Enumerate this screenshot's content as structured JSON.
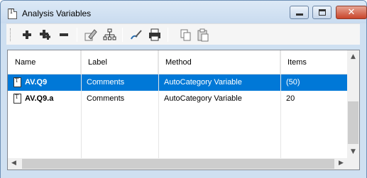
{
  "window": {
    "title": "Analysis Variables",
    "controls": {
      "minimize": "minimize",
      "maximize": "maximize",
      "close": "✕"
    }
  },
  "toolbar": {
    "buttons": [
      {
        "name": "add",
        "icon": "plus-icon"
      },
      {
        "name": "add-child",
        "icon": "plus-child-icon"
      },
      {
        "name": "remove",
        "icon": "minus-icon"
      },
      {
        "name": "edit",
        "icon": "pencil-edit-icon"
      },
      {
        "name": "hierarchy",
        "icon": "hierarchy-icon"
      },
      {
        "name": "style",
        "icon": "brush-icon"
      },
      {
        "name": "print",
        "icon": "printer-icon"
      },
      {
        "name": "copy",
        "icon": "copy-icon"
      },
      {
        "name": "paste",
        "icon": "paste-icon"
      }
    ]
  },
  "grid": {
    "columns": [
      "Name",
      "Label",
      "Method",
      "Items"
    ],
    "rows": [
      {
        "name": "AV.Q9",
        "label": "Comments",
        "method": "AutoCategory Variable",
        "items": "(50)",
        "selected": true
      },
      {
        "name": "AV.Q9.a",
        "label": "Comments",
        "method": "AutoCategory Variable",
        "items": "20",
        "selected": false
      }
    ]
  },
  "colors": {
    "selection": "#0078d7",
    "frame": "#cfe0f1",
    "close_button": "#c9452a"
  }
}
